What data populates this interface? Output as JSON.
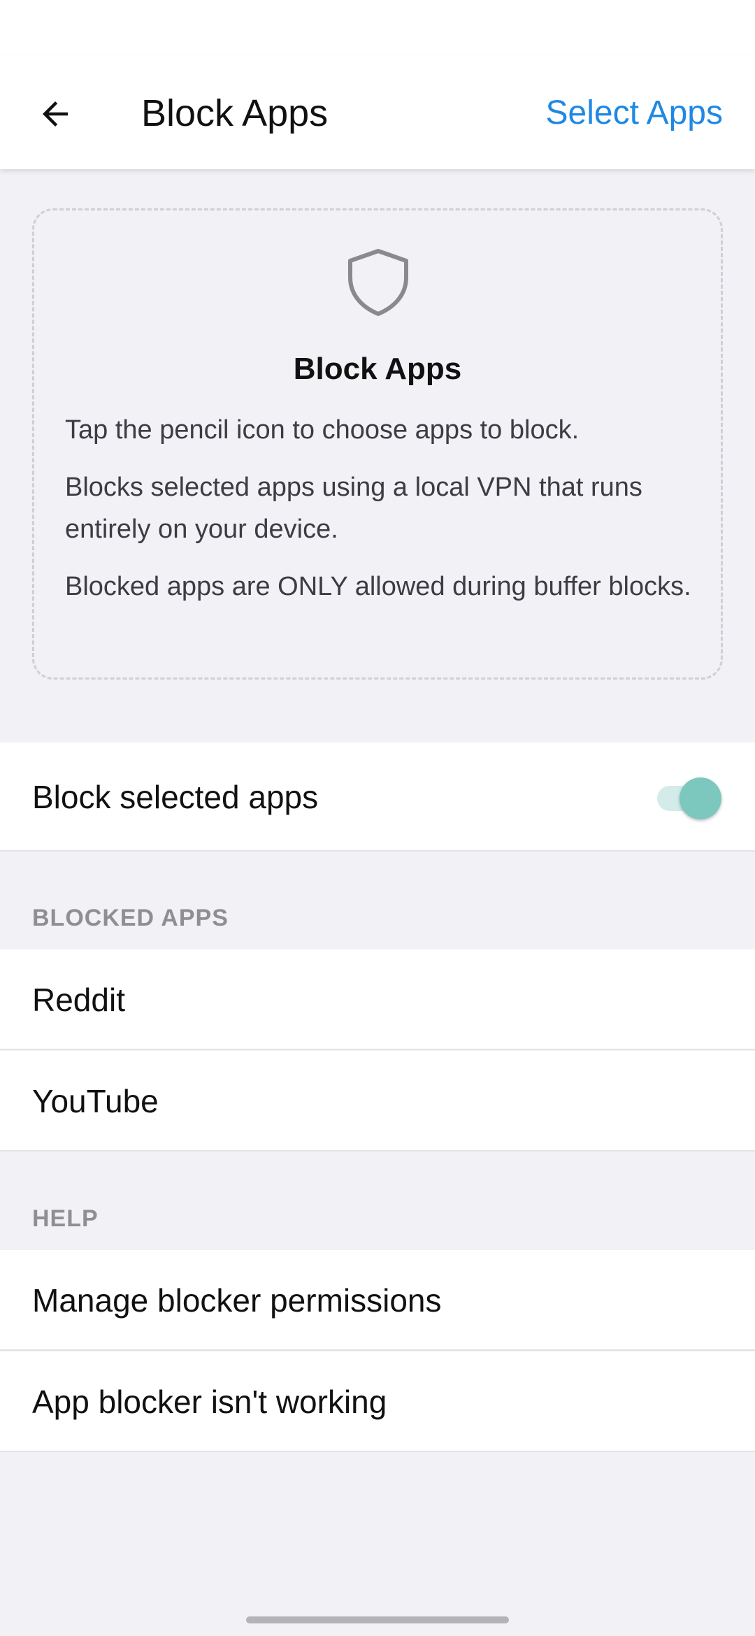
{
  "header": {
    "title": "Block Apps",
    "action_label": "Select Apps",
    "back_icon": "arrow-left-icon"
  },
  "info_card": {
    "icon": "shield-icon",
    "title": "Block Apps",
    "paragraphs": [
      "Tap the pencil icon to choose apps to block.",
      "Blocks selected apps using a local VPN that runs entirely on your device.",
      "Blocked apps are ONLY allowed during buffer blocks."
    ]
  },
  "toggle_row": {
    "label": "Block selected apps",
    "enabled": true
  },
  "blocked_apps": {
    "header": "BLOCKED APPS",
    "items": [
      "Reddit",
      "YouTube"
    ]
  },
  "help": {
    "header": "HELP",
    "items": [
      "Manage blocker permissions",
      "App blocker isn't working"
    ]
  },
  "colors": {
    "accent": "#1e88e5",
    "toggle_on": "#7cc8bf",
    "background": "#f1f1f6"
  }
}
